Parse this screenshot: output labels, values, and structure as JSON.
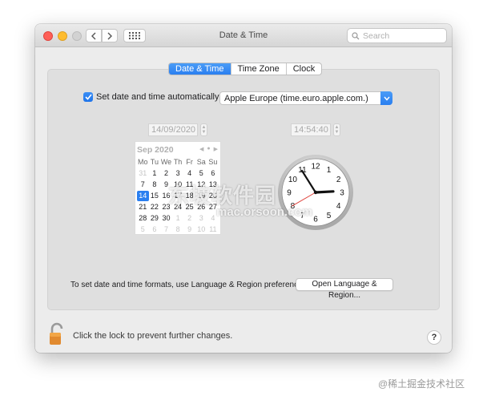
{
  "window": {
    "title": "Date & Time"
  },
  "toolbar": {
    "back_icon": "chevron-left-icon",
    "forward_icon": "chevron-right-icon",
    "grid_icon": "grid-icon"
  },
  "search": {
    "placeholder": "Search",
    "value": ""
  },
  "tabs": [
    {
      "label": "Date & Time",
      "active": true
    },
    {
      "label": "Time Zone",
      "active": false
    },
    {
      "label": "Clock",
      "active": false
    }
  ],
  "auto": {
    "checked": true,
    "label": "Set date and time automatically:",
    "server": "Apple Europe (time.euro.apple.com.)"
  },
  "date_field": {
    "value": "14/09/2020"
  },
  "time_field": {
    "value": "14:54:40"
  },
  "calendar": {
    "month_label": "Sep 2020",
    "weekdays": [
      "Mo",
      "Tu",
      "We",
      "Th",
      "Fr",
      "Sa",
      "Su"
    ],
    "weeks": [
      [
        "31",
        "1",
        "2",
        "3",
        "4",
        "5",
        "6"
      ],
      [
        "7",
        "8",
        "9",
        "10",
        "11",
        "12",
        "13"
      ],
      [
        "14",
        "15",
        "16",
        "17",
        "18",
        "19",
        "20"
      ],
      [
        "21",
        "22",
        "23",
        "24",
        "25",
        "26",
        "27"
      ],
      [
        "28",
        "29",
        "30",
        "1",
        "2",
        "3",
        "4"
      ],
      [
        "5",
        "6",
        "7",
        "8",
        "9",
        "10",
        "11"
      ]
    ],
    "today": "14"
  },
  "clock": {
    "numbers": [
      "12",
      "1",
      "2",
      "3",
      "4",
      "5",
      "6",
      "7",
      "8",
      "9",
      "10",
      "11"
    ],
    "time": "14:54:40"
  },
  "format_hint": "To set date and time formats, use Language & Region preferences.",
  "region_button": "Open Language & Region...",
  "lock_text": "Click the lock to prevent further changes.",
  "help_label": "?",
  "watermarks": {
    "center": "东坡软件园",
    "url": "mac.orsoon.com",
    "corner": "@稀土掘金技术社区"
  },
  "colors": {
    "accent": "#2a7ff0",
    "window_bg": "#ececec",
    "panel_bg": "#dfdfdf"
  }
}
